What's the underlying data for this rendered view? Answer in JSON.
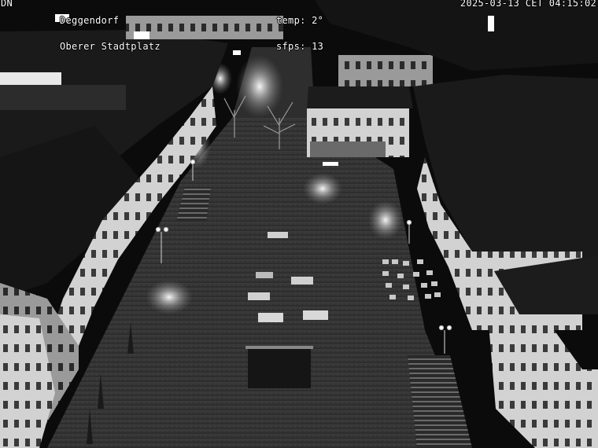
{
  "overlay": {
    "station_code": "DN",
    "city": "Deggendorf",
    "location": "Oberer Stadtplatz",
    "temperature": "temp: 2°",
    "fps": "sfps: 13",
    "timestamp": "2025-03-13 CET 04:15:02"
  },
  "scene": {
    "description_tone": "grayscale night webcam",
    "colors": {
      "sky": "#0b0b0b",
      "plaza": "#3a3a3a",
      "roof": "#1c1c1c",
      "facade": "#cfcfcf",
      "light": "#ffffff"
    }
  }
}
